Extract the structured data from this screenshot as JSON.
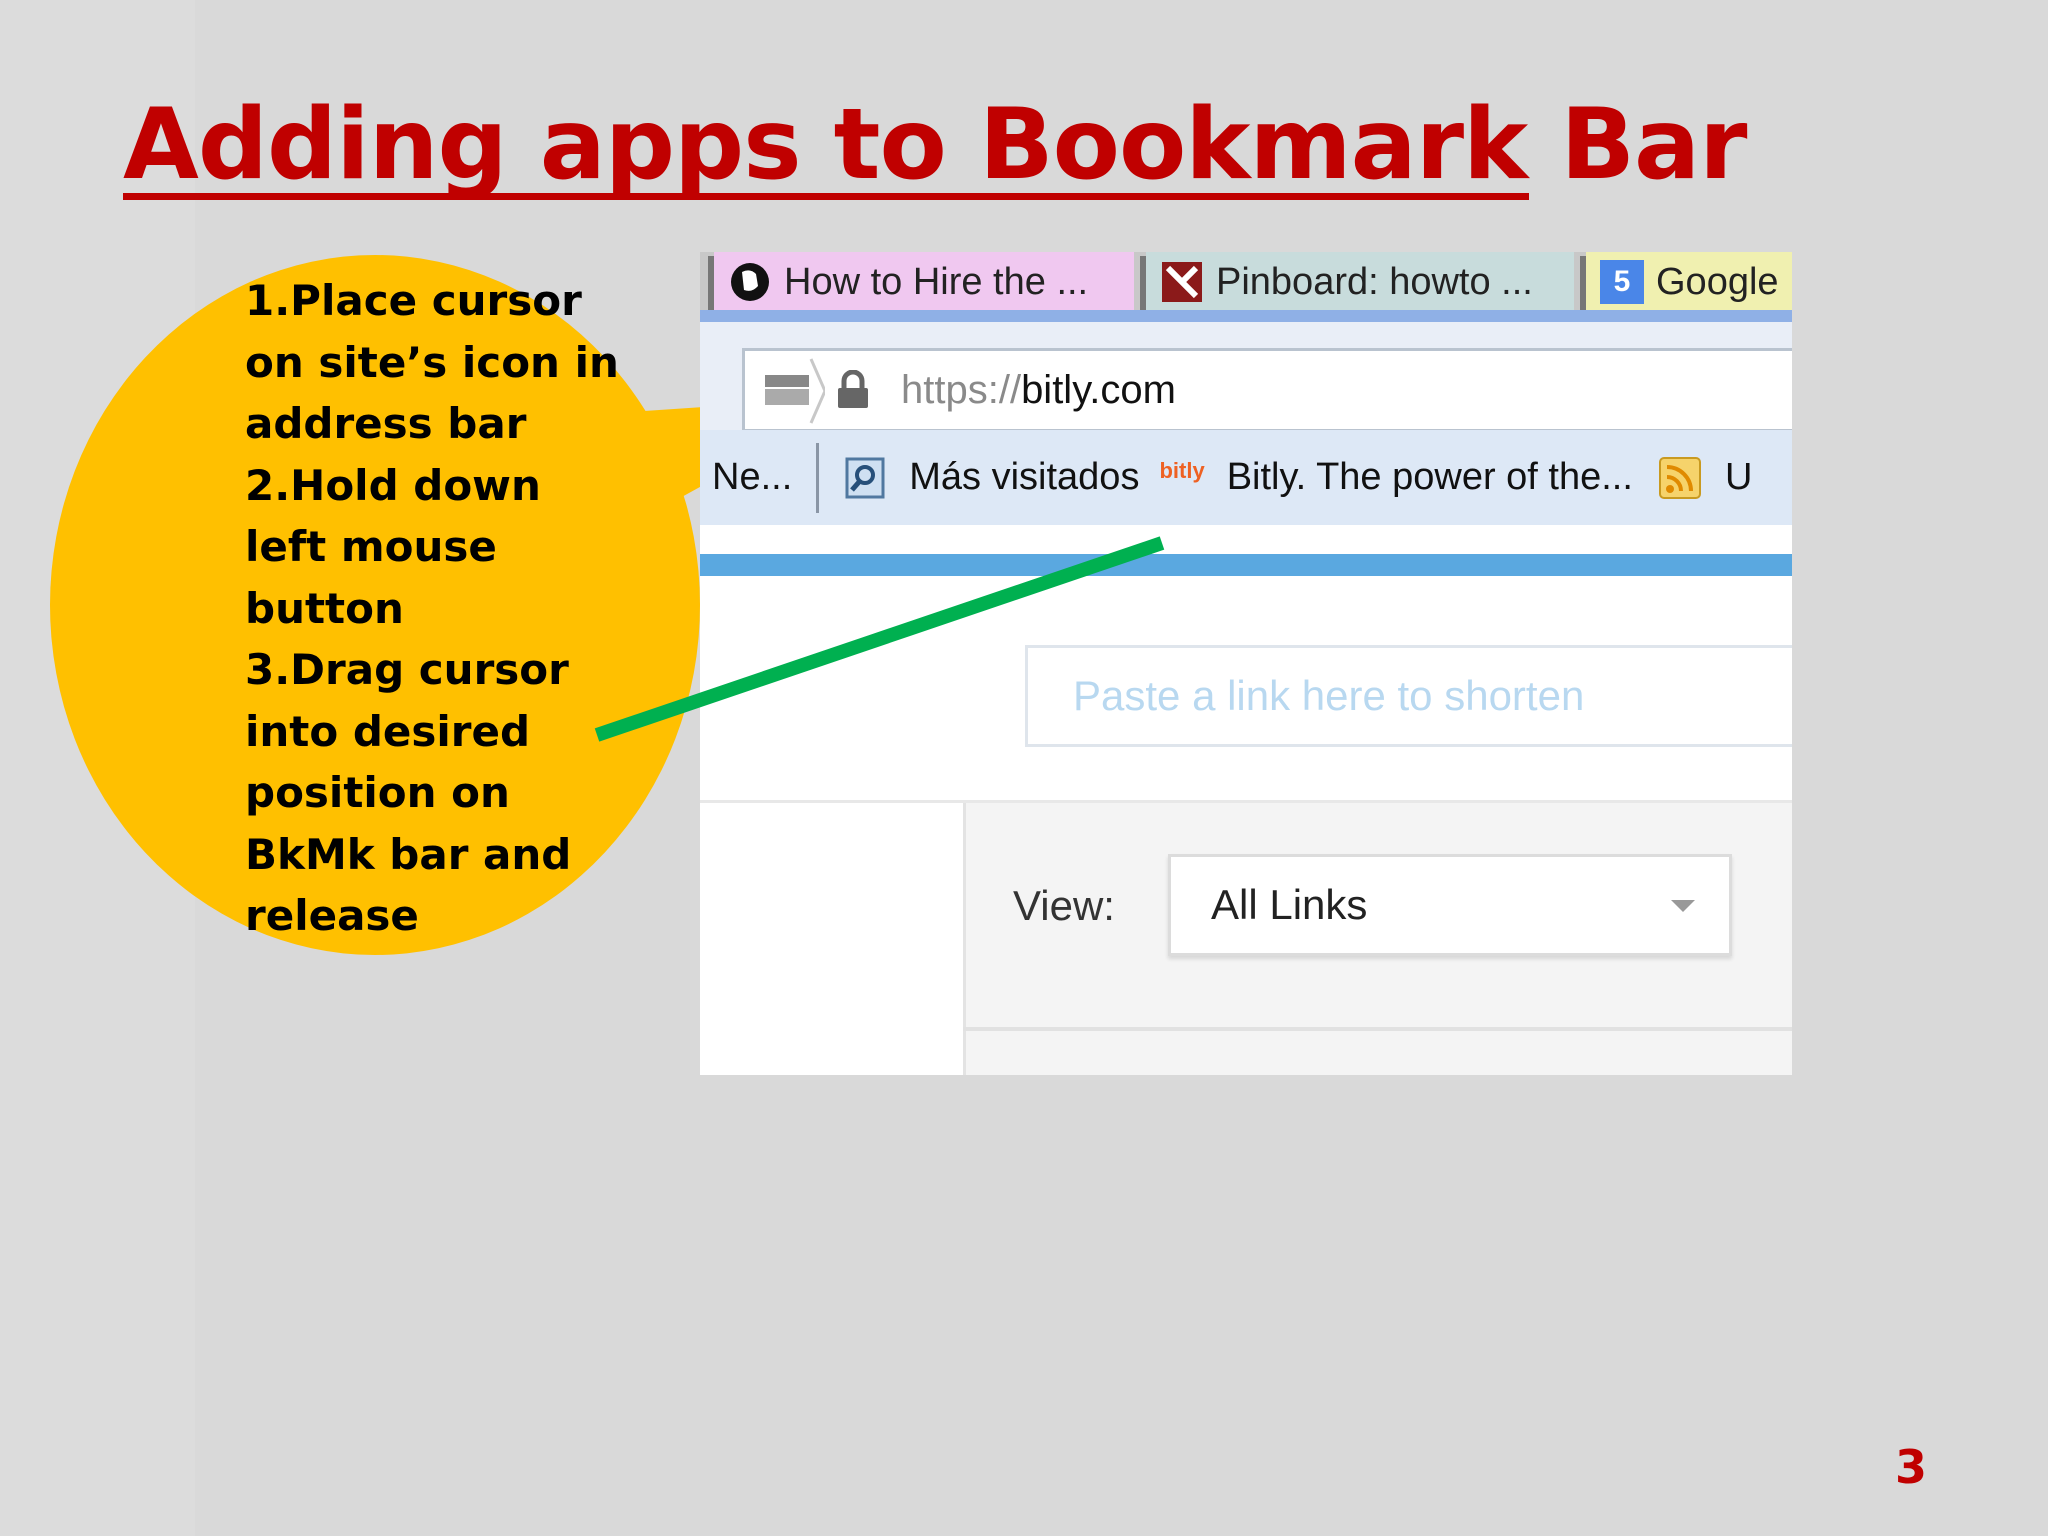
{
  "slide": {
    "title": "Adding apps to Bookmark Bar",
    "page_number": "3",
    "colors": {
      "title": "#c00000",
      "callout": "#ffc000",
      "arrow": "#00b050",
      "background": "#d9d9d9"
    }
  },
  "callout": {
    "lines": [
      "1.Place cursor",
      "on site’s icon in",
      "address bar",
      "2.Hold down",
      "left mouse",
      "button",
      "3.Drag cursor",
      "into desired",
      "position on",
      "BkMk bar and",
      "release"
    ]
  },
  "browser": {
    "tabs": [
      {
        "label": "How to Hire the ...",
        "icon": "circle-logo-icon",
        "color": "#f0c8f0"
      },
      {
        "label": "Pinboard: howto ...",
        "icon": "pin-icon",
        "color": "#c8dcdc"
      },
      {
        "label": "Google",
        "icon": "calendar-5-icon",
        "color": "#f0f0b0",
        "icon_text": "5"
      }
    ],
    "address": {
      "scheme": "https://",
      "host": "bitly.com"
    },
    "bookmarks": {
      "truncated": "Ne...",
      "items": [
        {
          "label": "Más visitados",
          "icon": "magnifier-folder-icon"
        },
        {
          "label": "Bitly. The power of the...",
          "icon": "bitly-icon",
          "icon_text": "bitly"
        },
        {
          "label": "U",
          "icon": "rss-icon"
        }
      ]
    },
    "page": {
      "shorten_placeholder": "Paste a link here to shorten",
      "view_label": "View:",
      "view_selected": "All Links"
    }
  }
}
